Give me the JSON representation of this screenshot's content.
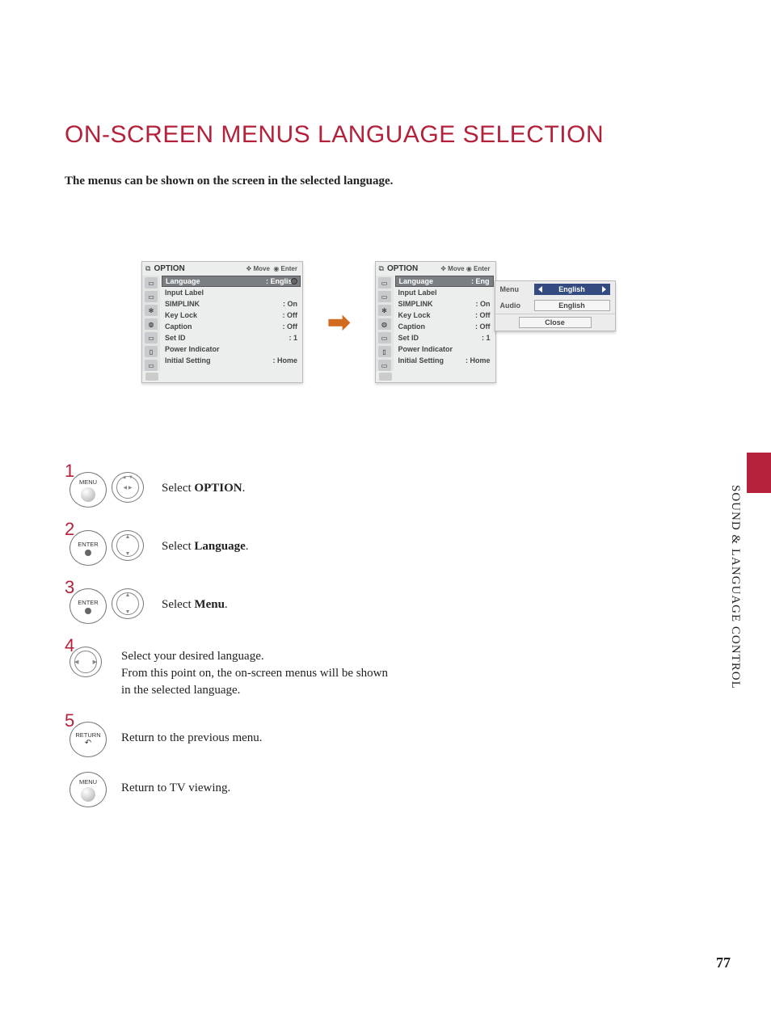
{
  "page": {
    "title": "ON-SCREEN MENUS LANGUAGE SELECTION",
    "intro": "The menus can be shown on the screen in the selected language.",
    "side_tab": "SOUND & LANGUAGE CONTROL",
    "number": "77"
  },
  "osd": {
    "title": "OPTION",
    "hint_move": "Move",
    "hint_enter": "Enter",
    "rows": [
      {
        "label": "Language",
        "value": ": English",
        "selected": true
      },
      {
        "label": "Input Label",
        "value": ""
      },
      {
        "label": "SIMPLINK",
        "value": ": On"
      },
      {
        "label": "Key Lock",
        "value": ": Off"
      },
      {
        "label": "Caption",
        "value": ": Off"
      },
      {
        "label": "Set ID",
        "value": ": 1"
      },
      {
        "label": "Power Indicator",
        "value": ""
      },
      {
        "label": "Initial Setting",
        "value": ": Home"
      }
    ],
    "rows2_value_trim": ": Eng"
  },
  "popup": {
    "rows": [
      {
        "label": "Menu",
        "value": "English",
        "highlight": true
      },
      {
        "label": "Audio",
        "value": "English",
        "highlight": false
      }
    ],
    "close": "Close"
  },
  "steps": {
    "s1": {
      "btn": "MENU",
      "text_prefix": "Select ",
      "text_bold": "OPTION",
      "text_suffix": "."
    },
    "s2": {
      "btn": "ENTER",
      "text_prefix": "Select ",
      "text_bold": "Language",
      "text_suffix": "."
    },
    "s3": {
      "btn": "ENTER",
      "text_prefix": "Select ",
      "text_bold": "Menu",
      "text_suffix": "."
    },
    "s4": {
      "line1": "Select your desired language.",
      "line2": "From this point on, the on-screen menus will be shown in the selected language."
    },
    "s5": {
      "btn": "RETURN",
      "text": "Return to the previous menu."
    },
    "s6": {
      "btn": "MENU",
      "text": "Return to TV viewing."
    }
  }
}
